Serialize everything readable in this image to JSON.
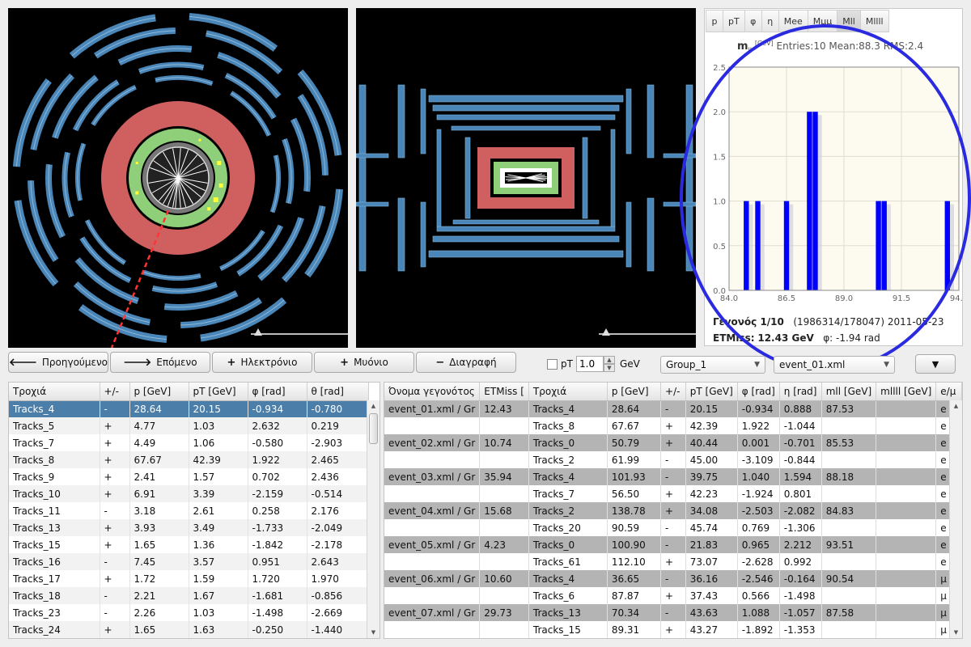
{
  "colors": {
    "background": "#000000",
    "calorimeter": "#d06060",
    "inner_detector": "#8fcf7a",
    "muon_chambers": "#4a86b8",
    "histogram_bars": "#0000ff",
    "annotation": "#2a2ae0",
    "selected_row": "#4b7ea8"
  },
  "viewers": {
    "xy": {
      "name": "event-display-xy"
    },
    "rz": {
      "name": "event-display-rz"
    }
  },
  "histogram": {
    "tabs": [
      "p",
      "pT",
      "φ",
      "η",
      "Mee",
      "Mμμ",
      "Mll",
      "Mllll"
    ],
    "active_tab": "Mll",
    "title_main": "m",
    "title_sub": "ll",
    "title_unit": "[GeV]",
    "title_stats": "Entries:10 Mean:88.3 RMS:2.4"
  },
  "chart_data": {
    "type": "bar",
    "title": "m_ll [GeV] Entries:10 Mean:88.3 RMS:2.4",
    "xlim": [
      84.0,
      94.0
    ],
    "ylim": [
      0.0,
      2.5
    ],
    "x_ticks": [
      "84.0",
      "86.5",
      "89.0",
      "91.5",
      "94.0"
    ],
    "y_ticks": [
      "0.0",
      "0.5",
      "1.0",
      "1.5",
      "2.0",
      "2.5"
    ],
    "bin_width": 0.25,
    "bins": [
      {
        "x": 84.75,
        "value": 1
      },
      {
        "x": 85.25,
        "value": 1
      },
      {
        "x": 86.5,
        "value": 1
      },
      {
        "x": 87.5,
        "value": 2
      },
      {
        "x": 87.75,
        "value": 2
      },
      {
        "x": 90.5,
        "value": 1
      },
      {
        "x": 90.75,
        "value": 1
      },
      {
        "x": 93.5,
        "value": 1
      }
    ],
    "grid": true
  },
  "event_info": {
    "event_label": "Γεγονός 1/10",
    "event_ids": "(1986314/178047) 2011-05-23",
    "etmiss_label": "ETMiss:",
    "etmiss_value": "12.43 GeV",
    "phi_text": "φ: -1.94 rad"
  },
  "toolbar": {
    "previous": "Προηγούμενο",
    "next": "Επόμενο",
    "electron": "Ηλεκτρόνιο",
    "muon": "Μυόνιο",
    "delete": "Διαγραφή",
    "pt_checkbox_label": "pT",
    "pt_threshold": "1.0",
    "unit": "GeV",
    "group_select": "Group_1",
    "file_select": "event_01.xml",
    "menu_glyph": "▼"
  },
  "tracks_table": {
    "columns": [
      "Τροχιά",
      "+/-",
      "p [GeV]",
      "pT [GeV]",
      "φ [rad]",
      "θ [rad]"
    ],
    "rows": [
      [
        "Tracks_4",
        "-",
        "28.64",
        "20.15",
        "-0.934",
        "-0.780"
      ],
      [
        "Tracks_5",
        "+",
        "4.77",
        "1.03",
        "2.632",
        "0.219"
      ],
      [
        "Tracks_7",
        "+",
        "4.49",
        "1.06",
        "-0.580",
        "-2.903"
      ],
      [
        "Tracks_8",
        "+",
        "67.67",
        "42.39",
        "1.922",
        "2.465"
      ],
      [
        "Tracks_9",
        "+",
        "2.41",
        "1.57",
        "0.702",
        "2.436"
      ],
      [
        "Tracks_10",
        "+",
        "6.91",
        "3.39",
        "-2.159",
        "-0.514"
      ],
      [
        "Tracks_11",
        "-",
        "3.18",
        "2.61",
        "0.258",
        "2.176"
      ],
      [
        "Tracks_13",
        "+",
        "3.93",
        "3.49",
        "-1.733",
        "-2.049"
      ],
      [
        "Tracks_15",
        "+",
        "1.65",
        "1.36",
        "-1.842",
        "-2.178"
      ],
      [
        "Tracks_16",
        "-",
        "7.45",
        "3.57",
        "0.951",
        "2.643"
      ],
      [
        "Tracks_17",
        "+",
        "1.72",
        "1.59",
        "1.720",
        "1.970"
      ],
      [
        "Tracks_18",
        "-",
        "2.21",
        "1.67",
        "-1.681",
        "-0.856"
      ],
      [
        "Tracks_23",
        "-",
        "2.26",
        "1.03",
        "-1.498",
        "-2.669"
      ],
      [
        "Tracks_24",
        "+",
        "1.65",
        "1.63",
        "-0.250",
        "-1.440"
      ]
    ]
  },
  "events_table": {
    "columns": [
      "Όνομα γεγονότος",
      "ETMiss [",
      "Τροχιά",
      "p [GeV]",
      "+/-",
      "pT [GeV]",
      "φ [rad]",
      "η [rad]",
      "mll [GeV]",
      "mllll [GeV]",
      "e/μ"
    ],
    "rows": [
      [
        "event_01.xml / Gr",
        "12.43",
        "Tracks_4",
        "28.64",
        "-",
        "20.15",
        "-0.934",
        "0.888",
        "87.53",
        "",
        "e"
      ],
      [
        "",
        "",
        "Tracks_8",
        "67.67",
        "+",
        "42.39",
        "1.922",
        "-1.044",
        "",
        "",
        "e"
      ],
      [
        "event_02.xml / Gr",
        "10.74",
        "Tracks_0",
        "50.79",
        "+",
        "40.44",
        "0.001",
        "-0.701",
        "85.53",
        "",
        "e"
      ],
      [
        "",
        "",
        "Tracks_2",
        "61.99",
        "-",
        "45.00",
        "-3.109",
        "-0.844",
        "",
        "",
        "e"
      ],
      [
        "event_03.xml / Gr",
        "35.94",
        "Tracks_4",
        "101.93",
        "-",
        "39.75",
        "1.040",
        "1.594",
        "88.18",
        "",
        "e"
      ],
      [
        "",
        "",
        "Tracks_7",
        "56.50",
        "+",
        "42.23",
        "-1.924",
        "0.801",
        "",
        "",
        "e"
      ],
      [
        "event_04.xml / Gr",
        "15.68",
        "Tracks_2",
        "138.78",
        "+",
        "34.08",
        "-2.503",
        "-2.082",
        "84.83",
        "",
        "e"
      ],
      [
        "",
        "",
        "Tracks_20",
        "90.59",
        "-",
        "45.74",
        "0.769",
        "-1.306",
        "",
        "",
        "e"
      ],
      [
        "event_05.xml / Gr",
        "4.23",
        "Tracks_0",
        "100.90",
        "-",
        "21.83",
        "0.965",
        "2.212",
        "93.51",
        "",
        "e"
      ],
      [
        "",
        "",
        "Tracks_61",
        "112.10",
        "+",
        "73.07",
        "-2.628",
        "0.992",
        "",
        "",
        "e"
      ],
      [
        "event_06.xml / Gr",
        "10.60",
        "Tracks_4",
        "36.65",
        "-",
        "36.16",
        "-2.546",
        "-0.164",
        "90.54",
        "",
        "μ"
      ],
      [
        "",
        "",
        "Tracks_6",
        "87.87",
        "+",
        "37.43",
        "0.566",
        "-1.498",
        "",
        "",
        "μ"
      ],
      [
        "event_07.xml / Gr",
        "29.73",
        "Tracks_13",
        "70.34",
        "-",
        "43.63",
        "1.088",
        "-1.057",
        "87.58",
        "",
        "μ"
      ],
      [
        "",
        "",
        "Tracks_15",
        "89.31",
        "+",
        "43.27",
        "-1.892",
        "-1.353",
        "",
        "",
        "μ"
      ]
    ]
  }
}
